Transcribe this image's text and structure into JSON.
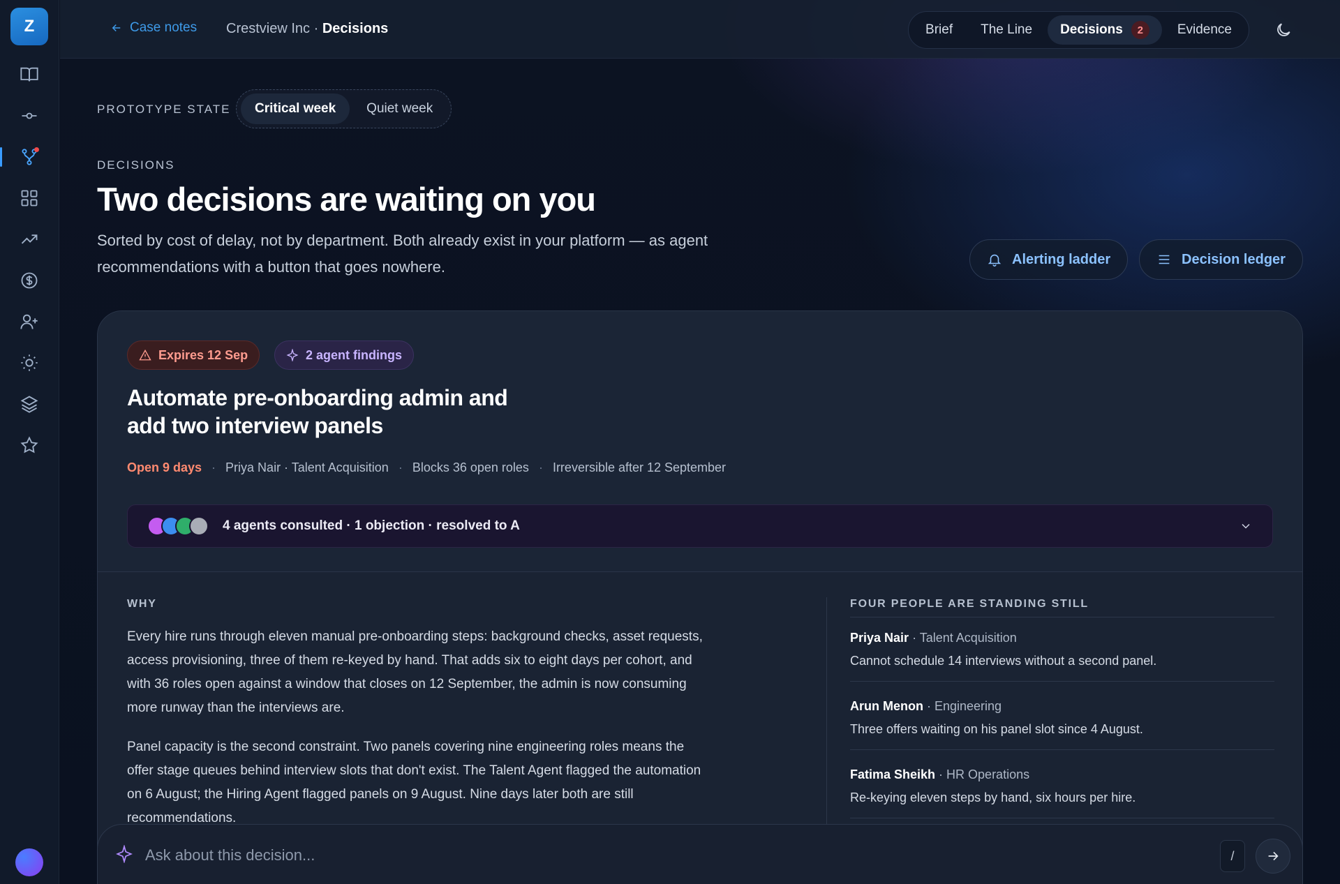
{
  "app": {
    "logo_letter": "Z"
  },
  "header": {
    "back_label": "Case notes",
    "crumb_company": "Crestview Inc · ",
    "crumb_page": "Decisions",
    "tabs": [
      {
        "label": "Brief"
      },
      {
        "label": "The Line"
      },
      {
        "label": "Decisions",
        "badge": "2"
      },
      {
        "label": "Evidence"
      }
    ]
  },
  "prototype": {
    "label": "PROTOTYPE STATE",
    "options": [
      "Critical week",
      "Quiet week"
    ],
    "selected": "Critical week"
  },
  "page": {
    "eyebrow": "DECISIONS",
    "title": "Two decisions are waiting on you",
    "subtitle": "Sorted by cost of delay, not by department. Both already exist in your platform — as agent recommendations with a button that goes nowhere.",
    "alert_button": "Alerting ladder",
    "ledger_button": "Decision ledger"
  },
  "decision": {
    "tag_expires": "Expires 12 Sep",
    "tag_agents": "2 agent findings",
    "title": "Automate pre-onboarding admin and add two interview panels",
    "meta": {
      "open": "Open 9 days",
      "owner": "Priya Nair · Talent Acquisition",
      "blocks": "Blocks 36 open roles",
      "deadline": "Irreversible after 12 September"
    },
    "consult_summary": "4 agents consulted · 1 objection · resolved to A",
    "agent_colors": [
      "#c45cf0",
      "#3c8ef0",
      "#2fae6a",
      "#a9adb6"
    ],
    "why_label": "WHY",
    "why_paragraphs": [
      "Every hire runs through eleven manual pre-onboarding steps: background checks, asset requests, access provisioning, three of them re-keyed by hand. That adds six to eight days per cohort, and with 36 roles open against a window that closes on 12 September, the admin is now consuming more runway than the interviews are.",
      "Panel capacity is the second constraint. Two panels covering nine engineering roles means the offer stage queues behind interview slots that don't exist. The Talent Agent flagged the automation on 6 August; the Hiring Agent flagged panels on 9 August. Nine days later both are still recommendations."
    ],
    "people_label": "FOUR PEOPLE ARE STANDING STILL",
    "people": [
      {
        "name": "Priya Nair",
        "role": " · Talent Acquisition",
        "note": "Cannot schedule 14 interviews without a second panel."
      },
      {
        "name": "Arun Menon",
        "role": " · Engineering",
        "note": "Three offers waiting on his panel slot since 4 August."
      },
      {
        "name": "Fatima Sheikh",
        "role": " · HR Operations",
        "note": "Re-keying eleven steps by hand, six hours per hire."
      }
    ]
  },
  "ask": {
    "placeholder": "Ask about this decision...",
    "shortcut": "/"
  }
}
